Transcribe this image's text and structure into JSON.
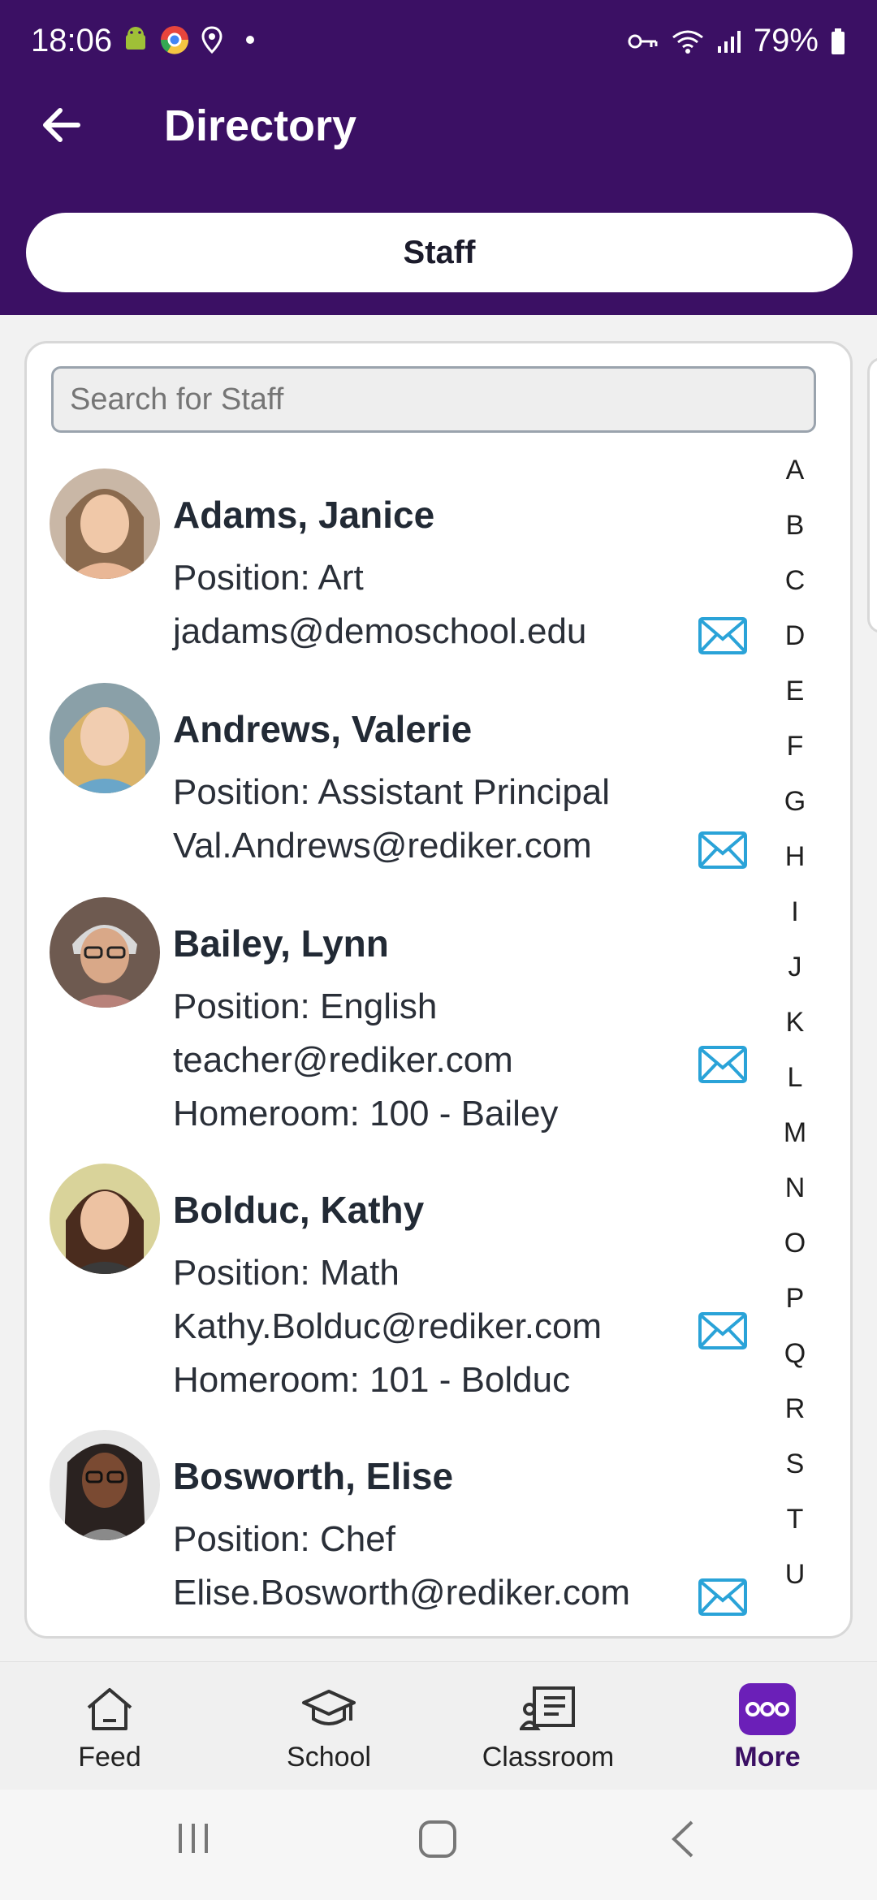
{
  "status": {
    "time": "18:06",
    "battery": "79%",
    "left_icons": [
      "android-icon",
      "chrome-icon",
      "location-icon",
      "dot-icon"
    ],
    "right_icons": [
      "key-icon",
      "wifi-icon",
      "signal-icon",
      "battery-icon"
    ]
  },
  "appbar": {
    "title": "Directory",
    "back_icon": "arrow-left-icon"
  },
  "tab_pill": {
    "label": "Staff"
  },
  "search": {
    "placeholder": "Search for Staff",
    "value": ""
  },
  "staff": [
    {
      "name": "Adams, Janice",
      "position": "Position: Art",
      "email": "jadams@demoschool.edu",
      "homeroom": ""
    },
    {
      "name": "Andrews, Valerie",
      "position": "Position: Assistant Principal",
      "email": "Val.Andrews@rediker.com",
      "homeroom": ""
    },
    {
      "name": "Bailey, Lynn",
      "position": "Position: English",
      "email": "teacher@rediker.com",
      "homeroom": "Homeroom: 100 - Bailey"
    },
    {
      "name": "Bolduc, Kathy",
      "position": "Position: Math",
      "email": "Kathy.Bolduc@rediker.com",
      "homeroom": "Homeroom: 101 - Bolduc"
    },
    {
      "name": "Bosworth, Elise",
      "position": "Position: Chef",
      "email": "Elise.Bosworth@rediker.com",
      "homeroom": ""
    }
  ],
  "alphabet": [
    "A",
    "B",
    "C",
    "D",
    "E",
    "F",
    "G",
    "H",
    "I",
    "J",
    "K",
    "L",
    "M",
    "N",
    "O",
    "P",
    "Q",
    "R",
    "S",
    "T",
    "U"
  ],
  "bottom_tabs": [
    {
      "label": "Feed",
      "icon": "home-icon",
      "active": false
    },
    {
      "label": "School",
      "icon": "graduation-cap-icon",
      "active": false
    },
    {
      "label": "Classroom",
      "icon": "presentation-icon",
      "active": false
    },
    {
      "label": "More",
      "icon": "more-dots-icon",
      "active": true
    }
  ],
  "colors": {
    "header": "#3b1064",
    "accent": "#6b1fb8",
    "mail": "#2aa3d8"
  }
}
